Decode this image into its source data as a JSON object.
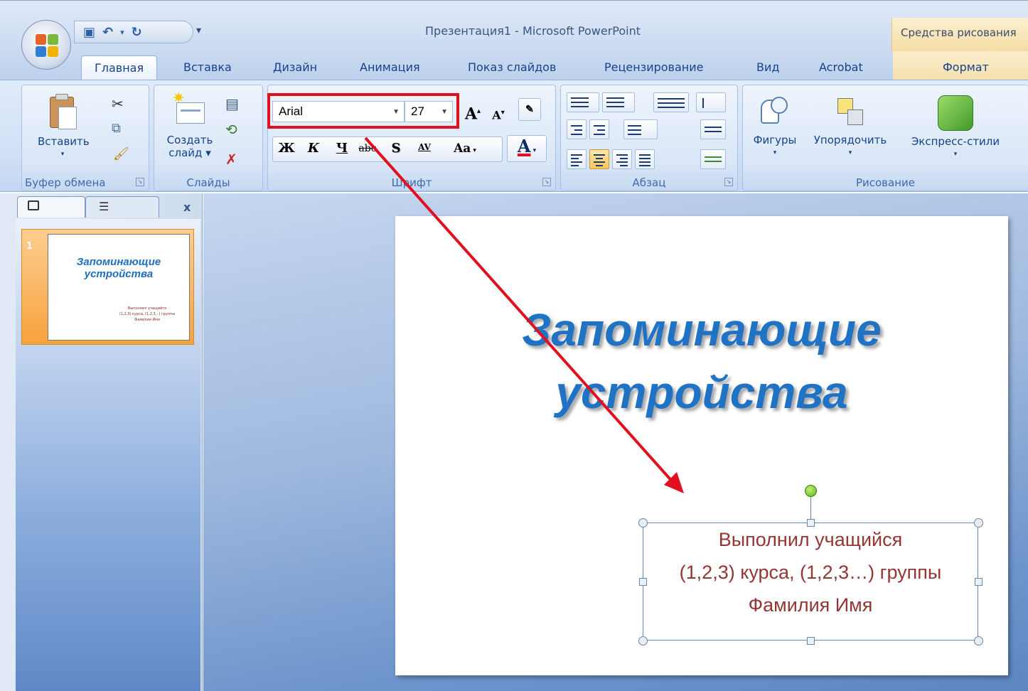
{
  "window": {
    "title": "Презентация1 - Microsoft PowerPoint",
    "contextual_tab_title": "Средства рисования"
  },
  "tabs": [
    "Главная",
    "Вставка",
    "Дизайн",
    "Анимация",
    "Показ слайдов",
    "Рецензирование",
    "Вид",
    "Acrobat",
    "Формат"
  ],
  "ribbon": {
    "clipboard": {
      "label": "Буфер обмена",
      "paste": "Вставить"
    },
    "slides": {
      "label": "Слайды",
      "new_slide_line1": "Создать",
      "new_slide_line2": "слайд"
    },
    "font": {
      "label": "Шрифт",
      "font_name": "Arial",
      "font_size": "27",
      "bold": "Ж",
      "italic": "К",
      "underline": "Ч",
      "strike": "abc",
      "shadow": "S",
      "spacing": "AV",
      "case": "Aa",
      "color": "A",
      "grow": "A",
      "shrink": "A"
    },
    "paragraph": {
      "label": "Абзац"
    },
    "drawing": {
      "label": "Рисование",
      "shapes": "Фигуры",
      "arrange": "Упорядочить",
      "quick_styles": "Экспресс-стили"
    }
  },
  "slides_pane": {
    "thumbnail_number": "1",
    "thumb_title": "Запоминающие устройства",
    "thumb_sub_lines": [
      "Выполнил учащийся",
      "(1,2,3) курса, (1,2,3...) группы",
      "Фамилия Имя"
    ]
  },
  "slide": {
    "title_line1": "Запоминающие",
    "title_line2": "устройства",
    "subtitle_line1": "Выполнил учащийся",
    "subtitle_line2": "(1,2,3) курса, (1,2,3…) группы",
    "subtitle_line3": "Фамилия Имя"
  },
  "colors": {
    "title_blue": "#1f72c4",
    "subtitle_red": "#943634",
    "annotation_red": "#e0101f",
    "ribbon_blue": "#15428b"
  },
  "icons": [
    "office-button-icon",
    "save-icon",
    "undo-icon",
    "redo-icon",
    "paste-icon",
    "cut-icon",
    "copy-icon",
    "format-painter-icon",
    "new-slide-icon",
    "layout-icon",
    "reset-icon",
    "delete-slide-icon",
    "bullets-icon",
    "numbering-icon",
    "align-left-icon",
    "align-center-icon",
    "align-right-icon",
    "justify-icon",
    "shapes-icon",
    "arrange-icon",
    "quick-styles-icon"
  ]
}
